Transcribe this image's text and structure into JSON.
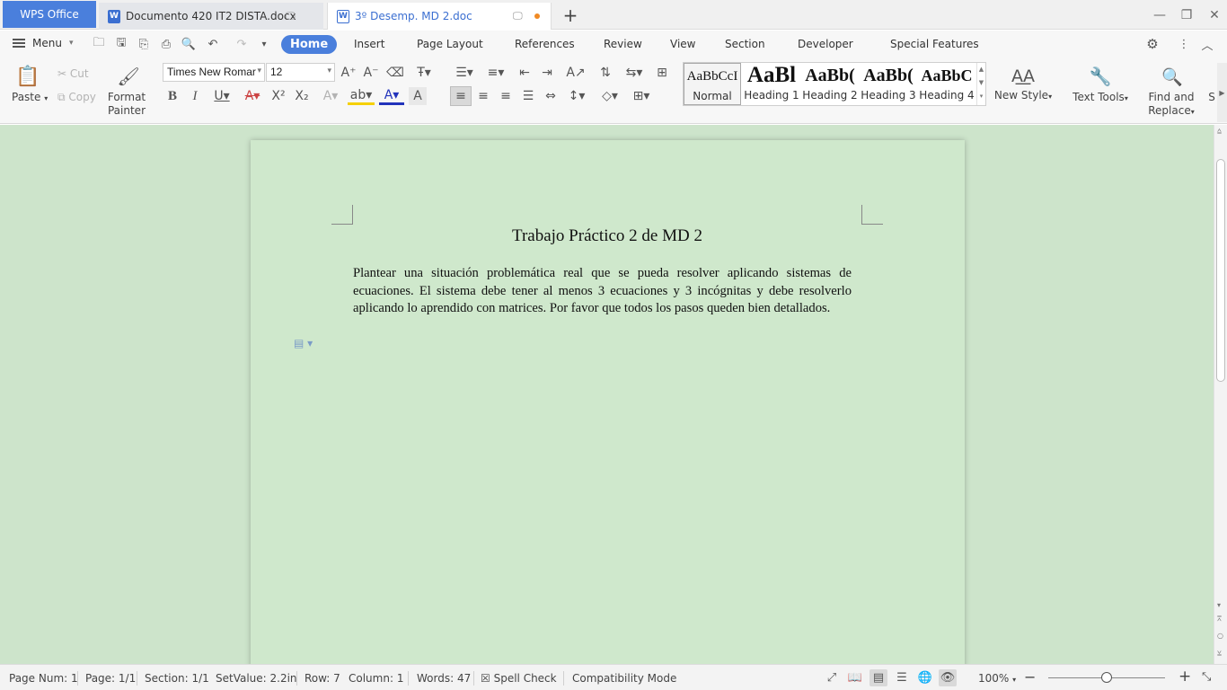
{
  "titlebar": {
    "app_tab": "WPS Office",
    "tabs": [
      {
        "label": "Documento 420 IT2 DISTA.docx",
        "icon": "word-doc-icon"
      },
      {
        "label": "3º Desemp. MD 2.doc",
        "icon": "word-doc-icon"
      }
    ],
    "new_tab": "+"
  },
  "menubar": {
    "menu_label": "Menu",
    "tabs": [
      "Home",
      "Insert",
      "Page Layout",
      "References",
      "Review",
      "View",
      "Section",
      "Developer",
      "Special Features"
    ],
    "active_tab": "Home"
  },
  "ribbon": {
    "paste": "Paste",
    "cut": "Cut",
    "copy": "Copy",
    "format_painter_line1": "Format",
    "format_painter_line2": "Painter",
    "font_name": "Times New Romar",
    "font_size": "12",
    "styles": [
      {
        "preview": "AaBbCcI",
        "name": "Normal"
      },
      {
        "preview": "AaBl",
        "name": "Heading 1"
      },
      {
        "preview": "AaBb(",
        "name": "Heading 2"
      },
      {
        "preview": "AaBb(",
        "name": "Heading 3"
      },
      {
        "preview": "AaBbC",
        "name": "Heading 4"
      }
    ],
    "new_style": "New Style",
    "text_tools": "Text Tools",
    "find_replace_line1": "Find and",
    "find_replace_line2": "Replace",
    "select_partial": "S"
  },
  "document": {
    "title": "Trabajo Práctico 2 de MD 2",
    "body": "Plantear una situación problemática real que se pueda resolver aplicando sistemas de ecuaciones. El sistema debe tener al menos 3 ecuaciones  y 3 incógnitas y debe resolverlo aplicando lo aprendido con matrices.  Por favor que todos los pasos queden bien detallados."
  },
  "statusbar": {
    "page_num": "Page Num: 1",
    "page": "Page: 1/1",
    "section": "Section: 1/1",
    "setvalue": "SetValue: 2.2in",
    "row": "Row: 7",
    "column": "Column: 1",
    "words": "Words: 47",
    "spell_check": "Spell Check",
    "compat_mode": "Compatibility Mode",
    "zoom": "100%"
  },
  "colors": {
    "accent": "#4a7fdc",
    "canvas_bg": "#cde4cb",
    "page_bg": "#cfe8cc"
  }
}
